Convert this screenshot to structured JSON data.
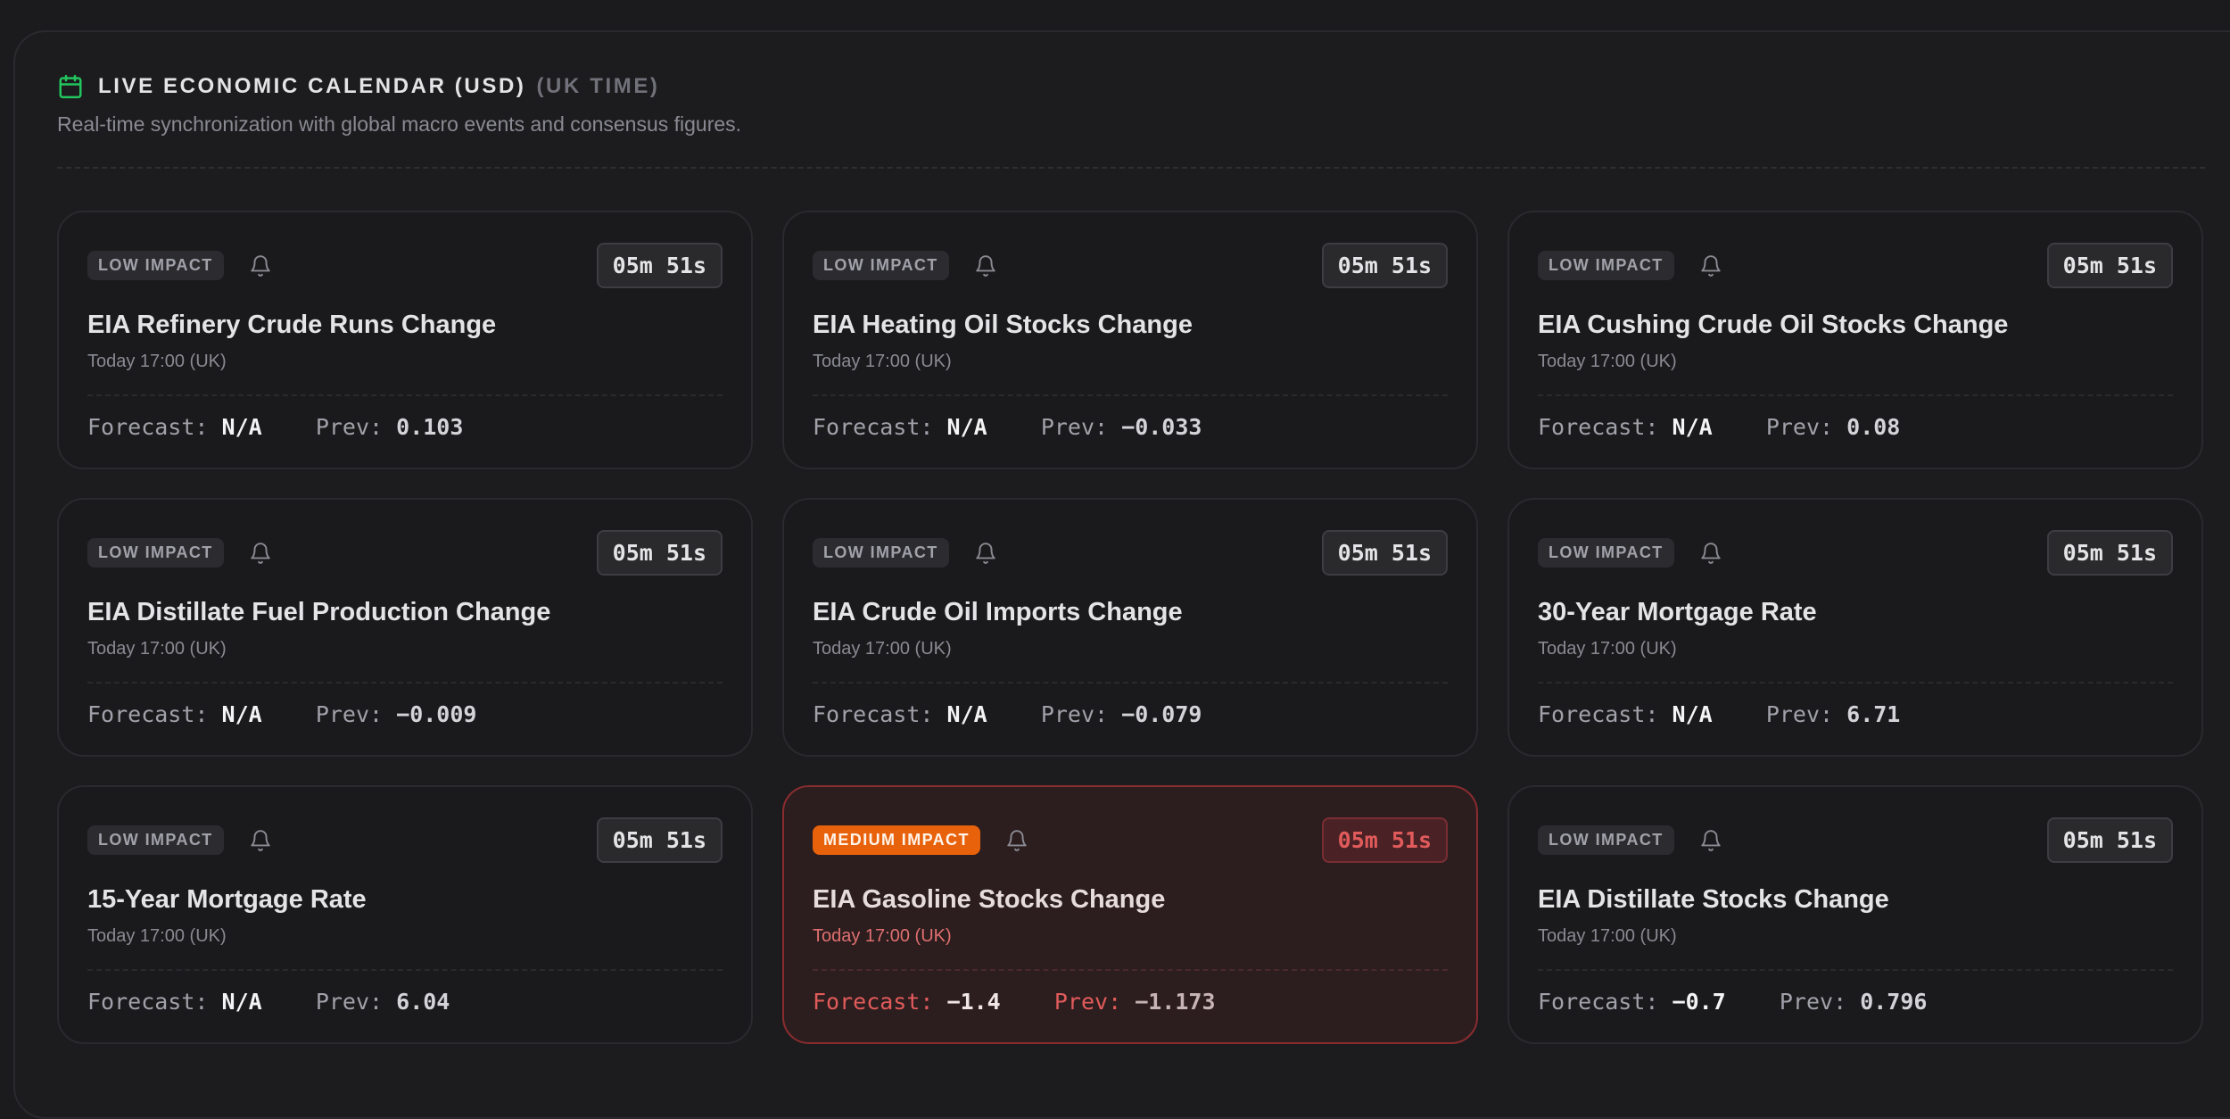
{
  "header": {
    "title": "LIVE ECONOMIC CALENDAR (USD)",
    "title_suffix": "(UK TIME)",
    "subtitle": "Real-time synchronization with global macro events and consensus figures."
  },
  "labels": {
    "forecast": "Forecast:",
    "prev": "Prev:"
  },
  "colors": {
    "accent_green": "#22c55e",
    "medium_impact": "#e8620c",
    "medium_alert_red": "#e25b5b"
  },
  "events": [
    {
      "impact": "LOW IMPACT",
      "countdown": "05m 51s",
      "name": "EIA Refinery Crude Runs Change",
      "time": "Today 17:00 (UK)",
      "forecast": "N/A",
      "prev": "0.103"
    },
    {
      "impact": "LOW IMPACT",
      "countdown": "05m 51s",
      "name": "EIA Heating Oil Stocks Change",
      "time": "Today 17:00 (UK)",
      "forecast": "N/A",
      "prev": "-0.033"
    },
    {
      "impact": "LOW IMPACT",
      "countdown": "05m 51s",
      "name": "EIA Cushing Crude Oil Stocks Change",
      "time": "Today 17:00 (UK)",
      "forecast": "N/A",
      "prev": "0.08"
    },
    {
      "impact": "LOW IMPACT",
      "countdown": "05m 51s",
      "name": "EIA Distillate Fuel Production Change",
      "time": "Today 17:00 (UK)",
      "forecast": "N/A",
      "prev": "-0.009"
    },
    {
      "impact": "LOW IMPACT",
      "countdown": "05m 51s",
      "name": "EIA Crude Oil Imports Change",
      "time": "Today 17:00 (UK)",
      "forecast": "N/A",
      "prev": "-0.079"
    },
    {
      "impact": "LOW IMPACT",
      "countdown": "05m 51s",
      "name": "30-Year Mortgage Rate",
      "time": "Today 17:00 (UK)",
      "forecast": "N/A",
      "prev": "6.71"
    },
    {
      "impact": "LOW IMPACT",
      "countdown": "05m 51s",
      "name": "15-Year Mortgage Rate",
      "time": "Today 17:00 (UK)",
      "forecast": "N/A",
      "prev": "6.04"
    },
    {
      "impact": "MEDIUM IMPACT",
      "countdown": "05m 51s",
      "name": "EIA Gasoline Stocks Change",
      "time": "Today 17:00 (UK)",
      "forecast": "-1.4",
      "prev": "-1.173"
    },
    {
      "impact": "LOW IMPACT",
      "countdown": "05m 51s",
      "name": "EIA Distillate Stocks Change",
      "time": "Today 17:00 (UK)",
      "forecast": "-0.7",
      "prev": "0.796"
    }
  ]
}
